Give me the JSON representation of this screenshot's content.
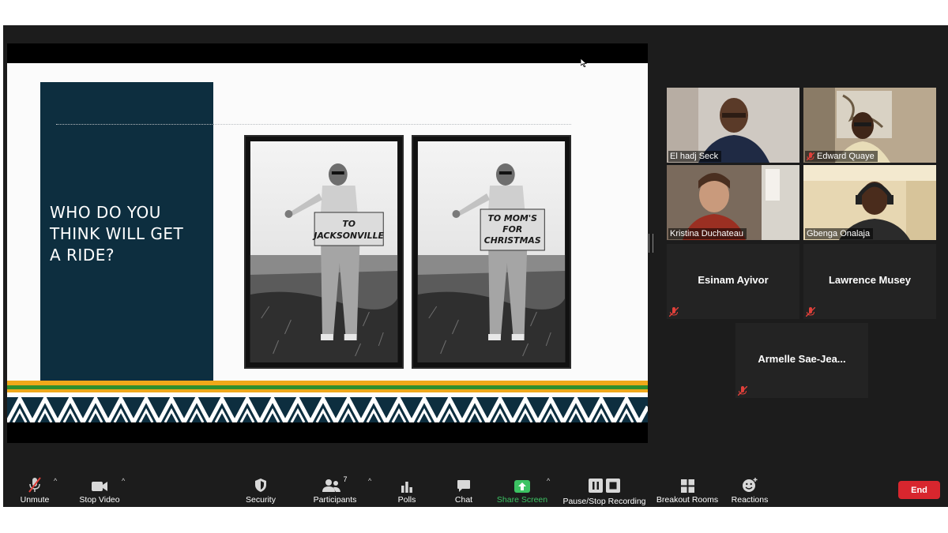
{
  "slide": {
    "title": "WHO DO YOU\nTHINK WILL GET\nA RIDE?",
    "sign_left_lines": [
      "TO",
      "JACKSONVILLE"
    ],
    "sign_right_lines": [
      "TO MOM'S",
      "FOR",
      "CHRISTMAS"
    ]
  },
  "gallery": [
    {
      "name": "El hadj Seck",
      "video": true,
      "muted": false,
      "active": false
    },
    {
      "name": "Edward Quaye",
      "video": true,
      "muted": true,
      "active": false
    },
    {
      "name": "Kristina Duchateau",
      "video": true,
      "muted": false,
      "active": false
    },
    {
      "name": "Gbenga Onalaja",
      "video": true,
      "muted": false,
      "active": true
    },
    {
      "name": "Esinam Ayivor",
      "video": false,
      "muted": true,
      "active": false
    },
    {
      "name": "Lawrence Musey",
      "video": false,
      "muted": true,
      "active": false
    },
    {
      "name": "Armelle  Sae-Jea...",
      "video": false,
      "muted": true,
      "active": false
    }
  ],
  "toolbar": {
    "unmute": "Unmute",
    "stop_video": "Stop Video",
    "security": "Security",
    "participants": "Participants",
    "participants_count": "7",
    "polls": "Polls",
    "chat": "Chat",
    "share_screen": "Share Screen",
    "recording": "Pause/Stop Recording",
    "breakout": "Breakout Rooms",
    "reactions": "Reactions",
    "end": "End"
  },
  "colors": {
    "slide_panel": "#0d2e3f",
    "active_speaker": "#c9e36a",
    "share_green": "#3cc363",
    "end_red": "#d8262e",
    "mute_red": "#e0403a"
  }
}
